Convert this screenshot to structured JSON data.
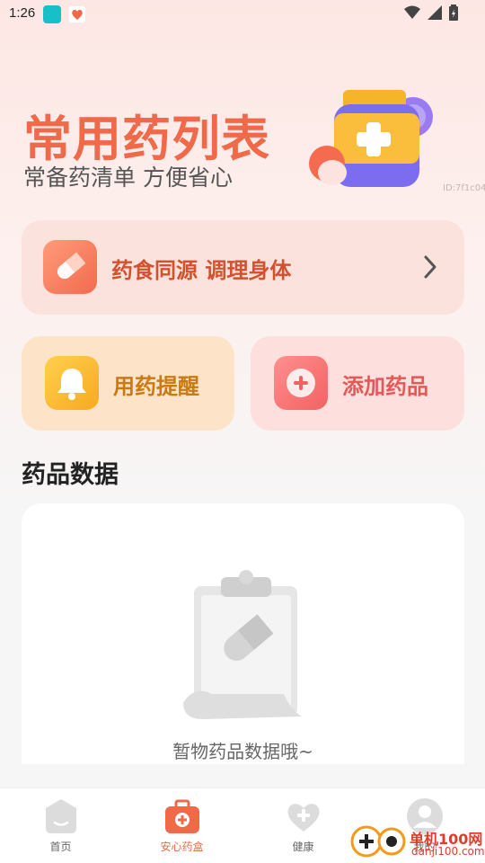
{
  "status_bar": {
    "time": "1:26"
  },
  "hero": {
    "title": "常用药列表",
    "subtitle": "常备药清单 方便省心",
    "image_id": "ID:7f1c04"
  },
  "banner": {
    "label": "药食同源 调理身体",
    "icon": "pill-icon",
    "arrow": "chevron-right-icon"
  },
  "actions": [
    {
      "label": "用药提醒",
      "icon": "bell-icon",
      "color": "#fde3c7"
    },
    {
      "label": "添加药品",
      "icon": "plus-icon",
      "color": "#fde0de"
    }
  ],
  "section": {
    "title": "药品数据"
  },
  "empty_state": {
    "text": "暂物药品数据哦~",
    "icon": "clipboard-pill-icon"
  },
  "tabbar": {
    "active_index": 1,
    "items": [
      {
        "label": "首页",
        "icon": "home-face-icon"
      },
      {
        "label": "安心药盒",
        "icon": "medkit-icon"
      },
      {
        "label": "健康",
        "icon": "heart-plus-icon"
      },
      {
        "label": "我的",
        "icon": "avatar-icon"
      }
    ]
  },
  "watermark": {
    "text": "单机100网",
    "url": "danji100.com"
  },
  "colors": {
    "accent": "#f06a4a",
    "background": "#fdf0ee"
  }
}
